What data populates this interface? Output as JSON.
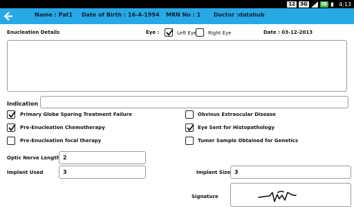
{
  "status_bar": {
    "badges": [
      "12",
      "3G",
      "ID"
    ],
    "icons": [
      "notification-badge-icon",
      "network-3g-icon",
      "signal-icon",
      "battery-icon"
    ],
    "time": "4:13"
  },
  "header": {
    "back_icon": "back-arrow-icon",
    "name": "Name : Pat1",
    "dob": "Date of Birth : 16-4-1994",
    "mrn": "MRN No : 1",
    "doctor": "Doctor :datahub",
    "background_color": "#29a8e6"
  },
  "form": {
    "enucleation_label": "Enucleation Details",
    "eye_label": "Eye :",
    "left_eye": {
      "label": "Left Eye",
      "checked": true
    },
    "right_eye": {
      "label": "Right Eye",
      "checked": false
    },
    "date": "Date : 03-12-2013",
    "details_value": "",
    "indication_label": "Indication",
    "indication_value": "",
    "checks_left": [
      {
        "label": "Primary Globe Sparing Treatment Failure",
        "checked": true
      },
      {
        "label": "Pre-Enucleation Chemotherapy",
        "checked": true
      },
      {
        "label": "Pre-Enucleation focal therapy",
        "checked": false
      }
    ],
    "checks_right": [
      {
        "label": "Obvious Extraocular Disease",
        "checked": false
      },
      {
        "label": "Eye Sent for Histopathology",
        "checked": true
      },
      {
        "label": "Tumer Sample Obtained for Genetics",
        "checked": false
      }
    ],
    "optic_nerve_label": "Optic Nerve Length",
    "optic_nerve_value": "2",
    "implant_used_label": "Implant Used",
    "implant_used_value": "3",
    "implant_size_label": "Implant Size",
    "implant_size_value": "3",
    "signature_label": "Signature"
  }
}
